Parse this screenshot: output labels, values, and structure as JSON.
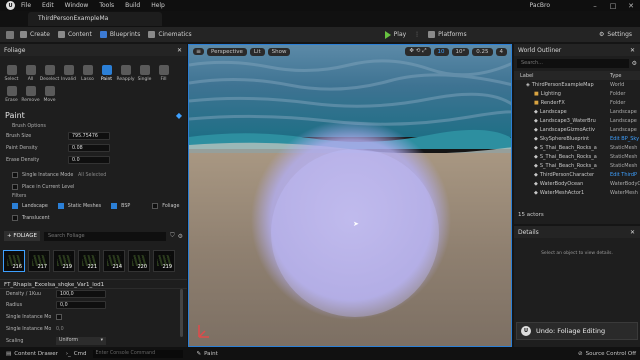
{
  "menu": [
    "File",
    "Edit",
    "Window",
    "Tools",
    "Build",
    "Help"
  ],
  "project_name": "PacBro",
  "tab_title": "ThirdPersonExampleMa",
  "toolbar": {
    "create": "Create",
    "content": "Content",
    "blueprints": "Blueprints",
    "cinematics": "Cinematics",
    "play": "Play",
    "platforms": "Platforms",
    "settings": "Settings"
  },
  "foliage_panel": {
    "title": "Foliage",
    "modes": [
      {
        "label": "Select"
      },
      {
        "label": "All"
      },
      {
        "label": "Deselect"
      },
      {
        "label": "Invalid"
      },
      {
        "label": "Lasso"
      },
      {
        "label": "Paint",
        "active": true
      },
      {
        "label": "Reapply"
      },
      {
        "label": "Single"
      },
      {
        "label": "Fill"
      },
      {
        "label": "Erase"
      },
      {
        "label": "Remove"
      },
      {
        "label": "Move"
      }
    ],
    "section": "Paint",
    "brush_options": "Brush Options",
    "brush_size_label": "Brush Size",
    "brush_size": "795.75476",
    "paint_density_label": "Paint Density",
    "paint_density": "0.08",
    "erase_density_label": "Erase Density",
    "erase_density": "0.0",
    "single_instance_mode": "Single Instance Mode",
    "all_selected": "All Selected",
    "place_in_level": "Place in Current Level",
    "filters": "Filters",
    "filter_landscape": "Landscape",
    "filter_static_meshes": "Static Meshes",
    "filter_bsp": "BSP",
    "filter_foliage": "Foliage",
    "filter_translucent": "Translucent",
    "add_foliage": "+ FOLIAGE",
    "search_placeholder": "Search Foliage",
    "thumbs": [
      "216",
      "217",
      "219",
      "221",
      "214",
      "220",
      "219"
    ],
    "mesh_name": "FT_Rhapis_Excelsa_shqke_Var1_lod1",
    "density_label": "Density / 1Kuu",
    "density": "100,0",
    "radius_label": "Radius",
    "radius": "0,0",
    "single_instance_label": "Single Instance Mo",
    "single_instance_mode_label": "Single Instance Mo",
    "single_instance_value": "0,0",
    "scaling_label": "Scaling",
    "scaling": "Uniform"
  },
  "viewport": {
    "perspective": "Perspective",
    "lit": "Lit",
    "show": "Show",
    "grid": "10",
    "angle": "10°",
    "scale": "0.25",
    "camera": "4"
  },
  "outliner": {
    "title": "World Outliner",
    "search_placeholder": "Search...",
    "label_col": "Label",
    "type_col": "Type",
    "rows": [
      {
        "label": "ThirdPersonExampleMap",
        "type": "World"
      },
      {
        "label": "Lighting",
        "type": "Folder"
      },
      {
        "label": "RenderFX",
        "type": "Folder"
      },
      {
        "label": "Landscape",
        "type": "Landscape"
      },
      {
        "label": "Landscape3_WaterBru",
        "type": "Landscape"
      },
      {
        "label": "LandscapeGizmoActiv",
        "type": "Landscape"
      },
      {
        "label": "SkySphereBlueprint",
        "type": "Edit BP_Sky"
      },
      {
        "label": "S_Thai_Beach_Rocks_a",
        "type": "StaticMesh"
      },
      {
        "label": "S_Thai_Beach_Rocks_a",
        "type": "StaticMesh"
      },
      {
        "label": "S_Thai_Beach_Rocks_a",
        "type": "StaticMesh"
      },
      {
        "label": "ThirdPersonCharacter",
        "type": "Edit ThirdP"
      },
      {
        "label": "WaterBodyOcean",
        "type": "WaterBodyO"
      },
      {
        "label": "WaterMeshActor1",
        "type": "WaterMesh"
      }
    ],
    "actors": "15 actors"
  },
  "details": {
    "title": "Details",
    "empty": "Select an object to view details."
  },
  "toast": {
    "text": "Undo: Foliage Editing"
  },
  "status": {
    "content_drawer": "Content Drawer",
    "cmd": "Cmd",
    "console_placeholder": "Enter Console Command",
    "mode": "Paint",
    "source_control": "Source Control Off"
  },
  "colors": {
    "accent": "#2b7fd6",
    "play": "#67c240",
    "brush": "#b9b4f0"
  }
}
